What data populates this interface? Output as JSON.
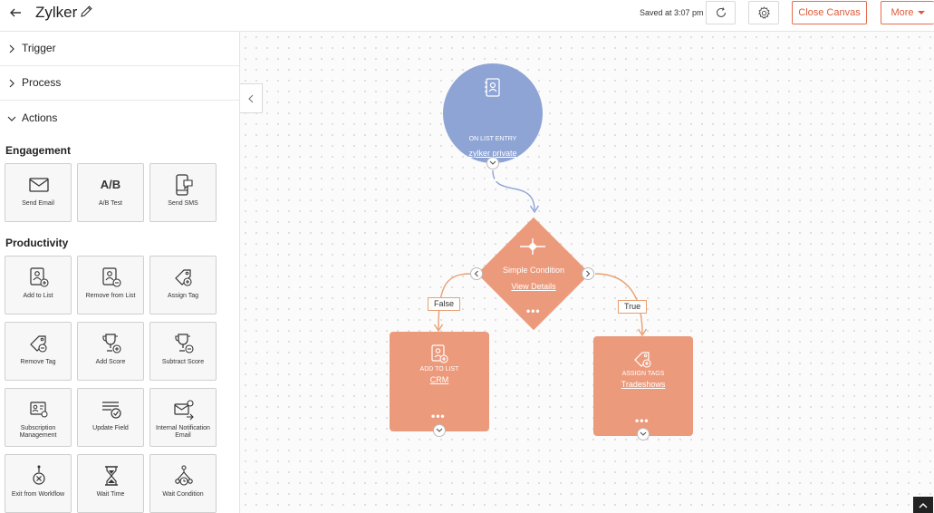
{
  "header": {
    "title": "Zylker",
    "saved_status": "Saved at 3:07 pm",
    "close_canvas_label": "Close Canvas",
    "more_label": "More"
  },
  "sidebar": {
    "accordions": {
      "trigger": "Trigger",
      "process": "Process",
      "actions": "Actions"
    },
    "engagement": {
      "title": "Engagement",
      "items": [
        {
          "label": "Send Email",
          "icon": "envelope-icon"
        },
        {
          "label": "A/B Test",
          "icon": "ab-test-icon",
          "glyph": "A/B"
        },
        {
          "label": "Send SMS",
          "icon": "sms-icon"
        }
      ]
    },
    "productivity": {
      "title": "Productivity",
      "items": [
        {
          "label": "Add to List",
          "icon": "add-contact-icon"
        },
        {
          "label": "Remove from List",
          "icon": "remove-contact-icon"
        },
        {
          "label": "Assign Tag",
          "icon": "tag-add-icon"
        },
        {
          "label": "Remove Tag",
          "icon": "tag-remove-icon"
        },
        {
          "label": "Add Score",
          "icon": "trophy-add-icon"
        },
        {
          "label": "Subtract Score",
          "icon": "trophy-subtract-icon"
        },
        {
          "label": "Subscription Management",
          "icon": "subscription-card-icon"
        },
        {
          "label": "Update Field",
          "icon": "update-field-icon"
        },
        {
          "label": "Internal Notification Email",
          "icon": "notification-email-icon"
        },
        {
          "label": "Exit from Workflow",
          "icon": "exit-workflow-icon"
        },
        {
          "label": "Wait Time",
          "icon": "hourglass-icon"
        },
        {
          "label": "Wait Condition",
          "icon": "wait-condition-icon"
        }
      ]
    }
  },
  "canvas": {
    "entry": {
      "label": "ON LIST ENTRY",
      "link": "zylker private",
      "dots": "•••"
    },
    "condition": {
      "title": "Simple Condition",
      "link": "View Details",
      "dots": "•••"
    },
    "false_branch": "False",
    "true_branch": "True",
    "false_action": {
      "label": "ADD TO LIST",
      "link": "CRM",
      "dots": "•••"
    },
    "true_action": {
      "label": "ASSIGN TAGS",
      "link": "Tradeshows",
      "dots": "•••"
    }
  },
  "colors": {
    "accent": "#e05a3a",
    "entry_node": "#8ea4d5",
    "action_node": "#ec9a7c",
    "connector_blue": "#8ea4d5",
    "connector_orange": "#e8a072"
  }
}
